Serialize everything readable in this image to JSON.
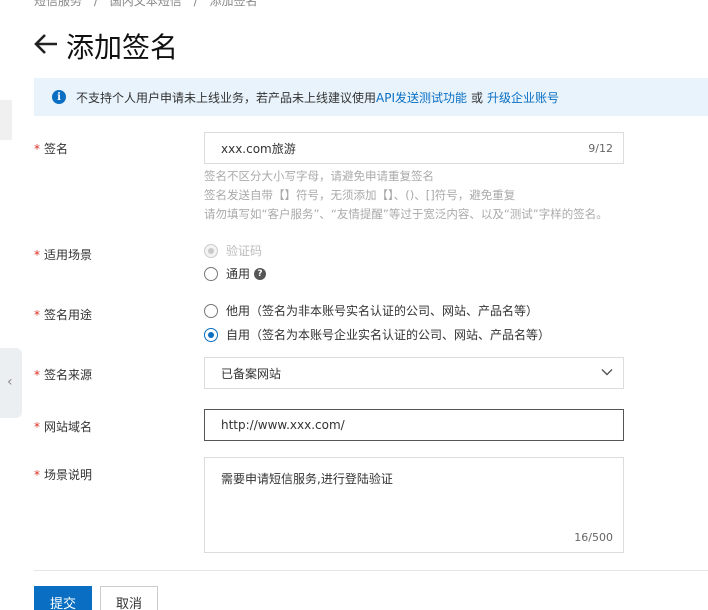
{
  "breadcrumb": [
    "短信服务",
    "/",
    "国内文本短信",
    "/",
    "添加签名"
  ],
  "page": {
    "title": "添加签名"
  },
  "notice": {
    "text": "不支持个人用户申请未上线业务，若产品未上线建议使用",
    "link1": "API发送测试功能",
    "or": "或",
    "link2": "升级企业账号"
  },
  "form": {
    "required_mark": "*",
    "signature": {
      "label": "签名",
      "value": "xxx.com旅游",
      "counter": "9/12"
    },
    "hints": [
      "签名不区分大小写字母，请避免申请重复签名",
      "签名发送自带【】符号，无须添加【】、()、[]符号，避免重复",
      "请勿填写如“客户服务”、“友情提醒”等过于宽泛内容、以及“测试”字样的签名。"
    ],
    "scenario": {
      "label": "适用场景",
      "options": [
        "验证码",
        "通用"
      ],
      "help_icon_text": "?"
    },
    "purpose": {
      "label": "签名用途",
      "options": [
        "他用（签名为非本账号实名认证的公司、网站、产品名等）",
        "自用（签名为本账号企业实名认证的公司、网站、产品名等）"
      ]
    },
    "source": {
      "label": "签名来源",
      "value": "已备案网站"
    },
    "domain": {
      "label": "网站域名",
      "value": "http://www.xxx.com/"
    },
    "description": {
      "label": "场景说明",
      "value": "需要申请短信服务,进行登陆验证",
      "counter": "16/500"
    }
  },
  "buttons": {
    "submit": "提交",
    "cancel": "取消"
  },
  "colors": {
    "primary": "#0a6fc2",
    "required": "#d93026",
    "notice_bg": "#e8f3fb"
  },
  "icons": {
    "back": "arrow-left-icon",
    "info": "info-icon",
    "help": "help-icon",
    "select_caret": "chevron-down-icon",
    "collapse": "chevron-left-icon"
  }
}
